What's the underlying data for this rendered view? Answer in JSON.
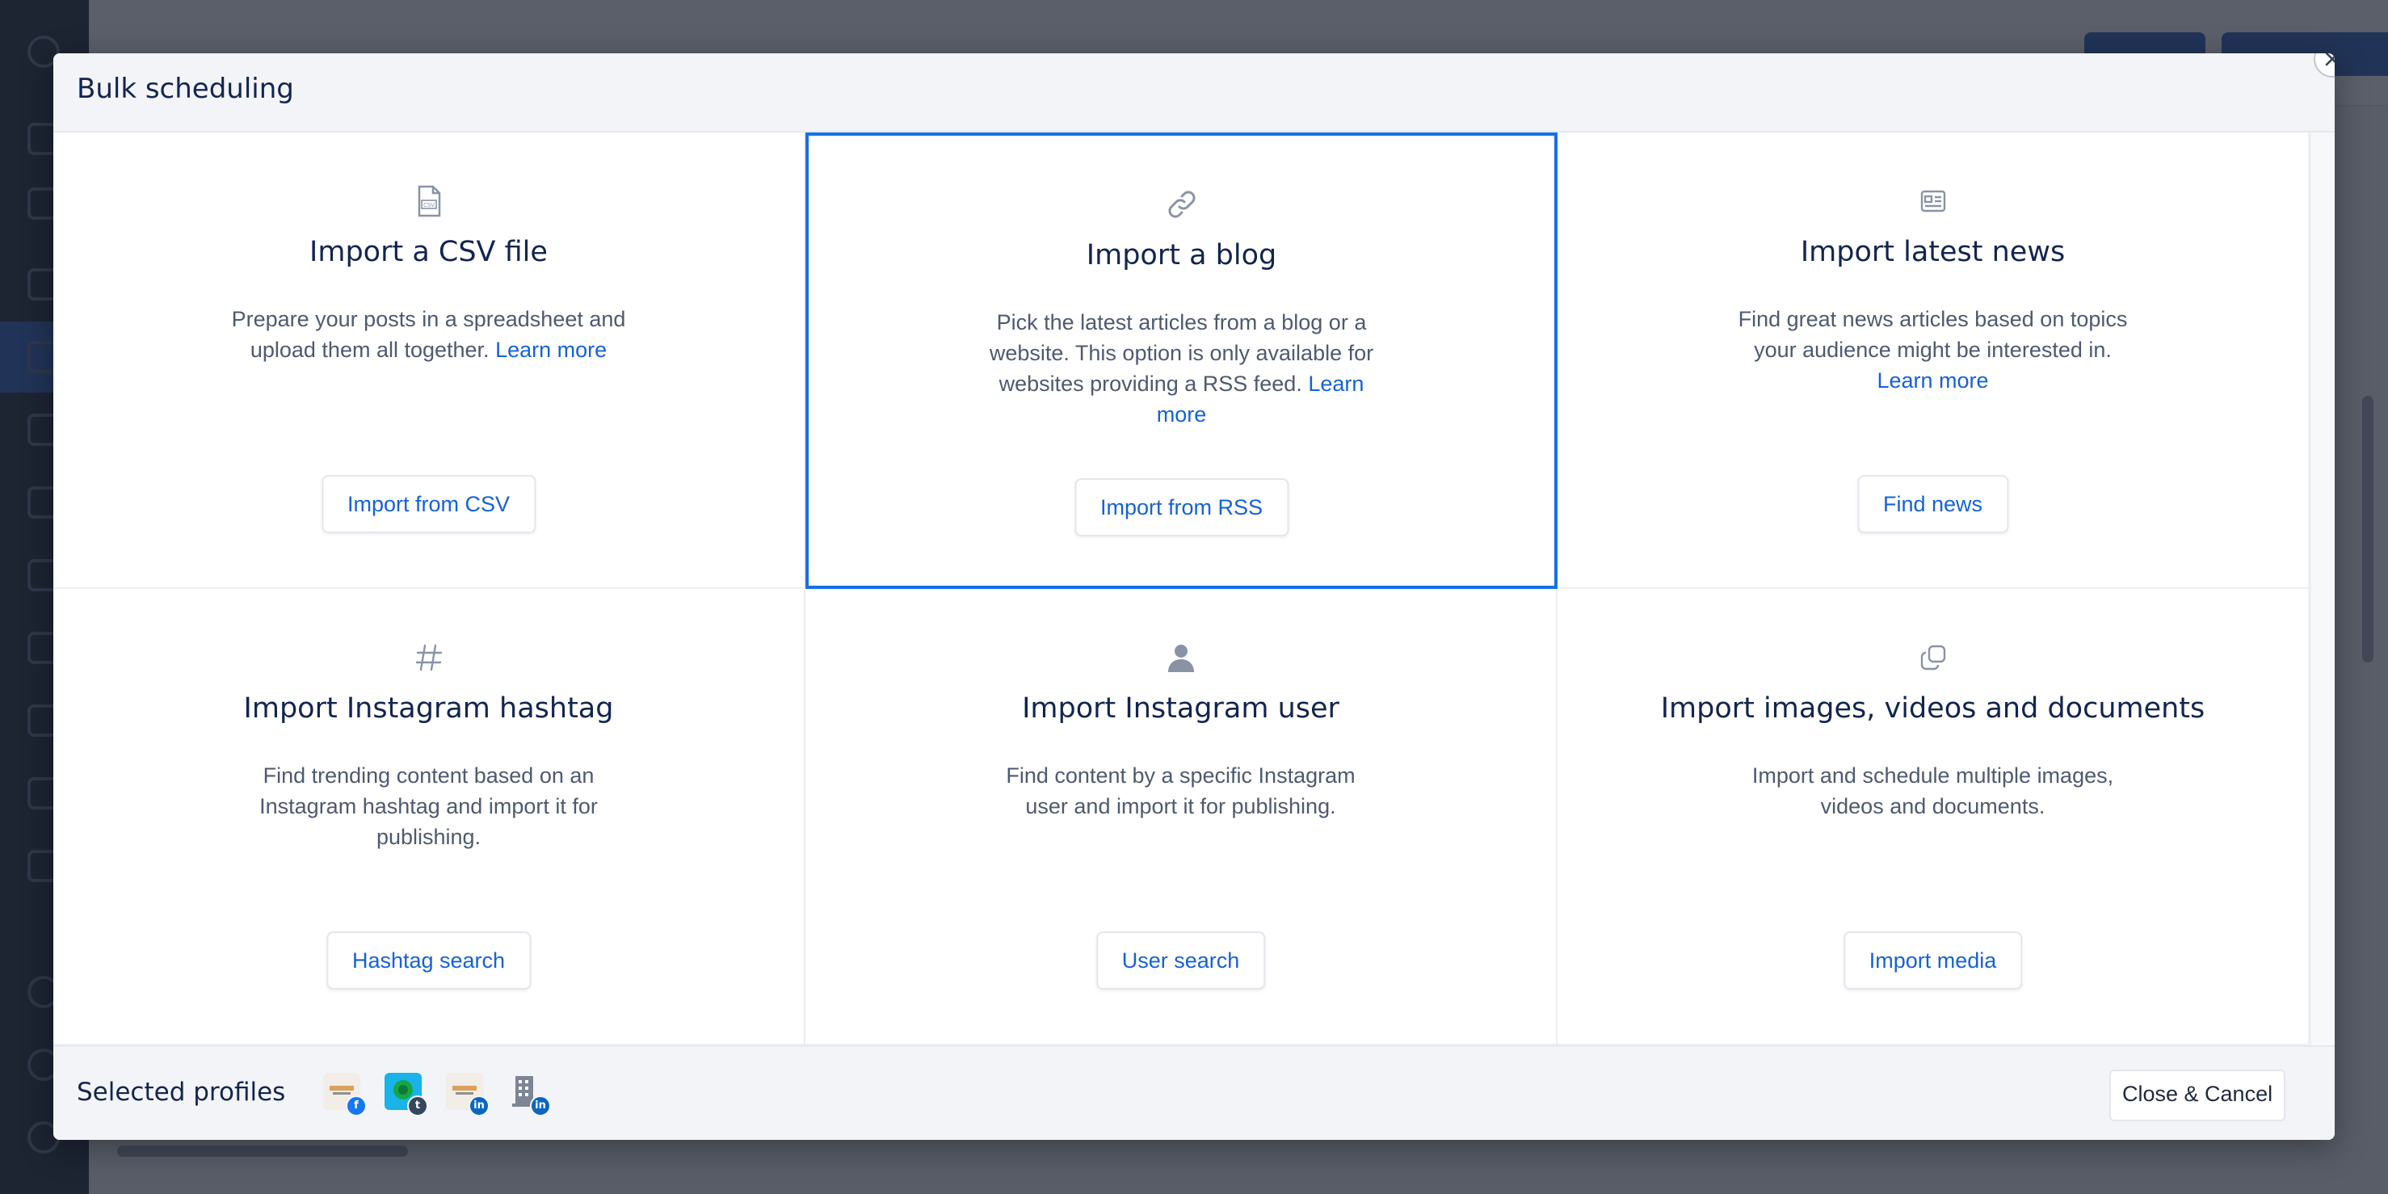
{
  "modal": {
    "title": "Bulk scheduling",
    "close_icon": "close-icon"
  },
  "options": [
    {
      "id": "csv",
      "icon": "csv-file-icon",
      "title": "Import a CSV file",
      "description": "Prepare your posts in a spreadsheet and upload them all together. ",
      "learn_more": "Learn more",
      "button": "Import from CSV",
      "selected": false
    },
    {
      "id": "blog",
      "icon": "link-icon",
      "title": "Import a blog",
      "description": "Pick the latest articles from a blog or a website. This option is only available for websites providing a RSS feed. ",
      "learn_more": "Learn more",
      "button": "Import from RSS",
      "selected": true
    },
    {
      "id": "news",
      "icon": "newspaper-icon",
      "title": "Import latest news",
      "description": "Find great news articles based on topics your audience might be interested in. ",
      "learn_more": "Learn more",
      "button": "Find news",
      "selected": false
    },
    {
      "id": "hashtag",
      "icon": "hashtag-icon",
      "title": "Import Instagram hashtag",
      "description": "Find trending content based on an Instagram hashtag and import it for publishing.",
      "learn_more": "",
      "button": "Hashtag search",
      "selected": false
    },
    {
      "id": "user",
      "icon": "user-icon",
      "title": "Import Instagram user",
      "description": "Find content by a specific Instagram user and import it for publishing.",
      "learn_more": "",
      "button": "User search",
      "selected": false
    },
    {
      "id": "media",
      "icon": "copy-icon",
      "title": "Import images, videos and documents",
      "description": "Import and schedule multiple images, videos and documents.",
      "learn_more": "",
      "button": "Import media",
      "selected": false
    }
  ],
  "footer": {
    "selected_profiles_label": "Selected profiles",
    "profiles": [
      {
        "name": "profile-facebook",
        "network": "facebook",
        "badge_letter": "f",
        "badge_color": "#1877f2"
      },
      {
        "name": "profile-tumblr",
        "network": "tumblr",
        "badge_letter": "t",
        "badge_color": "#36465d"
      },
      {
        "name": "profile-linkedin",
        "network": "linkedin",
        "badge_letter": "in",
        "badge_color": "#0a66c2"
      },
      {
        "name": "profile-linkedin-company",
        "network": "linkedin",
        "badge_letter": "in",
        "badge_color": "#0a66c2"
      }
    ],
    "close_cancel": "Close & Cancel"
  },
  "colors": {
    "accent": "#1462d9",
    "selected_border": "#1570e6",
    "title": "#13254f"
  }
}
